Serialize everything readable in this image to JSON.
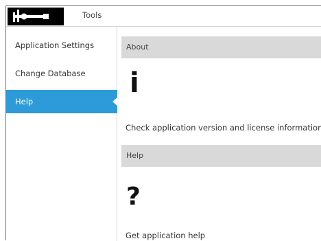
{
  "header": {
    "title": "Tools",
    "logo_icon": "caliper-icon"
  },
  "sidebar": {
    "items": [
      {
        "label": "Application Settings",
        "active": false
      },
      {
        "label": "Change Database",
        "active": false
      },
      {
        "label": "Help",
        "active": true
      }
    ]
  },
  "sections": [
    {
      "header": "About",
      "icon": "info-icon",
      "glyph": "i",
      "description": "Check application version and license information"
    },
    {
      "header": "Help",
      "icon": "question-icon",
      "glyph": "?",
      "description": "Get application help"
    }
  ],
  "colors": {
    "accent": "#2d9ad9",
    "section_header_bg": "#d9d9d9",
    "logo_bg": "#000000"
  }
}
